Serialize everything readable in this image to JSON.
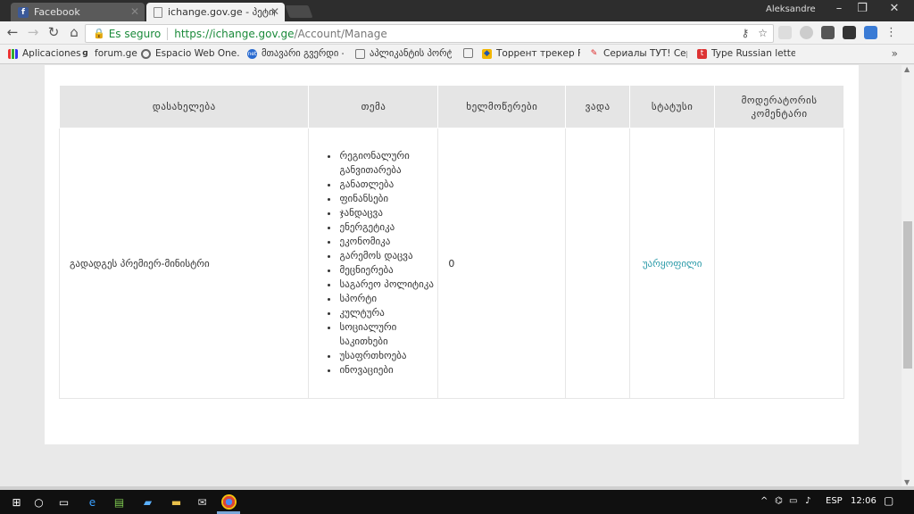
{
  "tabs": [
    {
      "title": "Facebook",
      "icon": "facebook-icon"
    },
    {
      "title": "ichange.gov.ge - პეტიცი",
      "icon": "page-icon"
    }
  ],
  "user": "Aleksandre",
  "omnibox": {
    "secure_label": "Es seguro",
    "url_scheme": "https://",
    "url_host": "ichange.gov.ge",
    "url_path": "/Account/Manage"
  },
  "bookmarks": [
    {
      "label": "Aplicaciones",
      "icon": "apps-icon"
    },
    {
      "label": "forum.ge",
      "icon": "forum-icon"
    },
    {
      "label": "Espacio Web One.com",
      "icon": "one-icon"
    },
    {
      "label": "მთავარი გვერდი -",
      "icon": "net-icon"
    },
    {
      "label": "აპლიკანტის პორტ",
      "icon": "page-icon"
    },
    {
      "label": "",
      "icon": "page-icon"
    },
    {
      "label": "Торрент трекер Free",
      "icon": "torrent-icon"
    },
    {
      "label": "Сериалы ТУТ! Сериа",
      "icon": "serials-icon"
    },
    {
      "label": "Type Russian letters -",
      "icon": "type-icon"
    }
  ],
  "table": {
    "headers": [
      "დასახელება",
      "თემა",
      "ხელმოწერები",
      "ვადა",
      "სტატუსი",
      "მოდერატორის კომენტარი"
    ],
    "rows": [
      {
        "name": "გადადგეს პრემიერ-მინისტრი",
        "topics": [
          "რეგიონალური განვითარება",
          "განათლება",
          "ფინანსები",
          "ჯანდაცვა",
          "ენერგეტიკა",
          "ეკონომიკა",
          "გარემოს დაცვა",
          "მეცნიერება",
          "საგარეო პოლიტიკა",
          "სპორტი",
          "კულტურა",
          "სოციალური საკითხები",
          "უსაფრთხოება",
          "ინოვაციები"
        ],
        "signatures": "0",
        "deadline": "",
        "status": "უარყოფილი",
        "comment": ""
      }
    ]
  },
  "taskbar": {
    "language": "ESP",
    "time": "12:06"
  },
  "colors": {
    "status_link": "#2a9aa8",
    "secure_green": "#1a8a3a",
    "header_bg": "#e5e5e5"
  }
}
